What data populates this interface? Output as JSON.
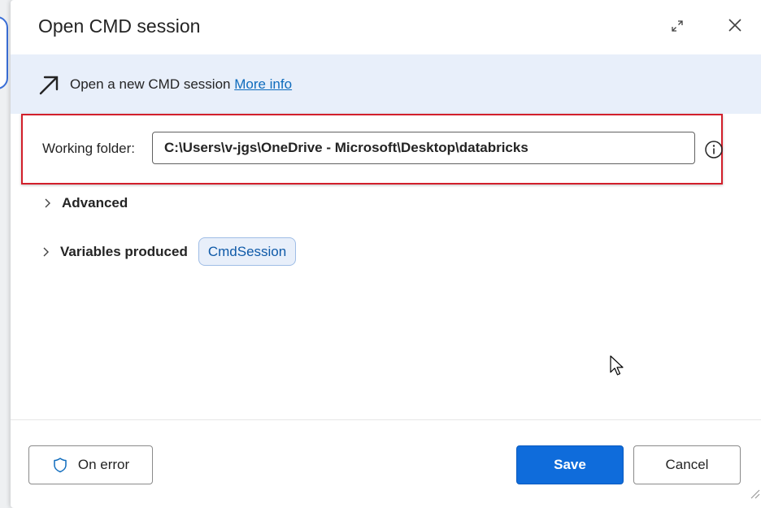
{
  "dialog": {
    "title": "Open CMD session",
    "expand_icon": "expand-icon",
    "close_icon": "close-icon"
  },
  "banner": {
    "icon": "arrow-up-right-icon",
    "text": "Open a new CMD session ",
    "link": "More info"
  },
  "params": {
    "working_folder_label": "Working folder:",
    "working_folder_value": "C:\\Users\\v-jgs\\OneDrive - Microsoft\\Desktop\\databricks",
    "info_icon": "info-icon"
  },
  "advanced": {
    "label": "Advanced"
  },
  "variables": {
    "label": "Variables produced",
    "chips": [
      "CmdSession"
    ]
  },
  "footer": {
    "on_error_label": "On error",
    "save_label": "Save",
    "cancel_label": "Cancel"
  },
  "colors": {
    "accent": "#0f6cdb",
    "banner_bg": "#e8effa",
    "highlight": "#d21f2b",
    "link": "#0f6cbd"
  }
}
